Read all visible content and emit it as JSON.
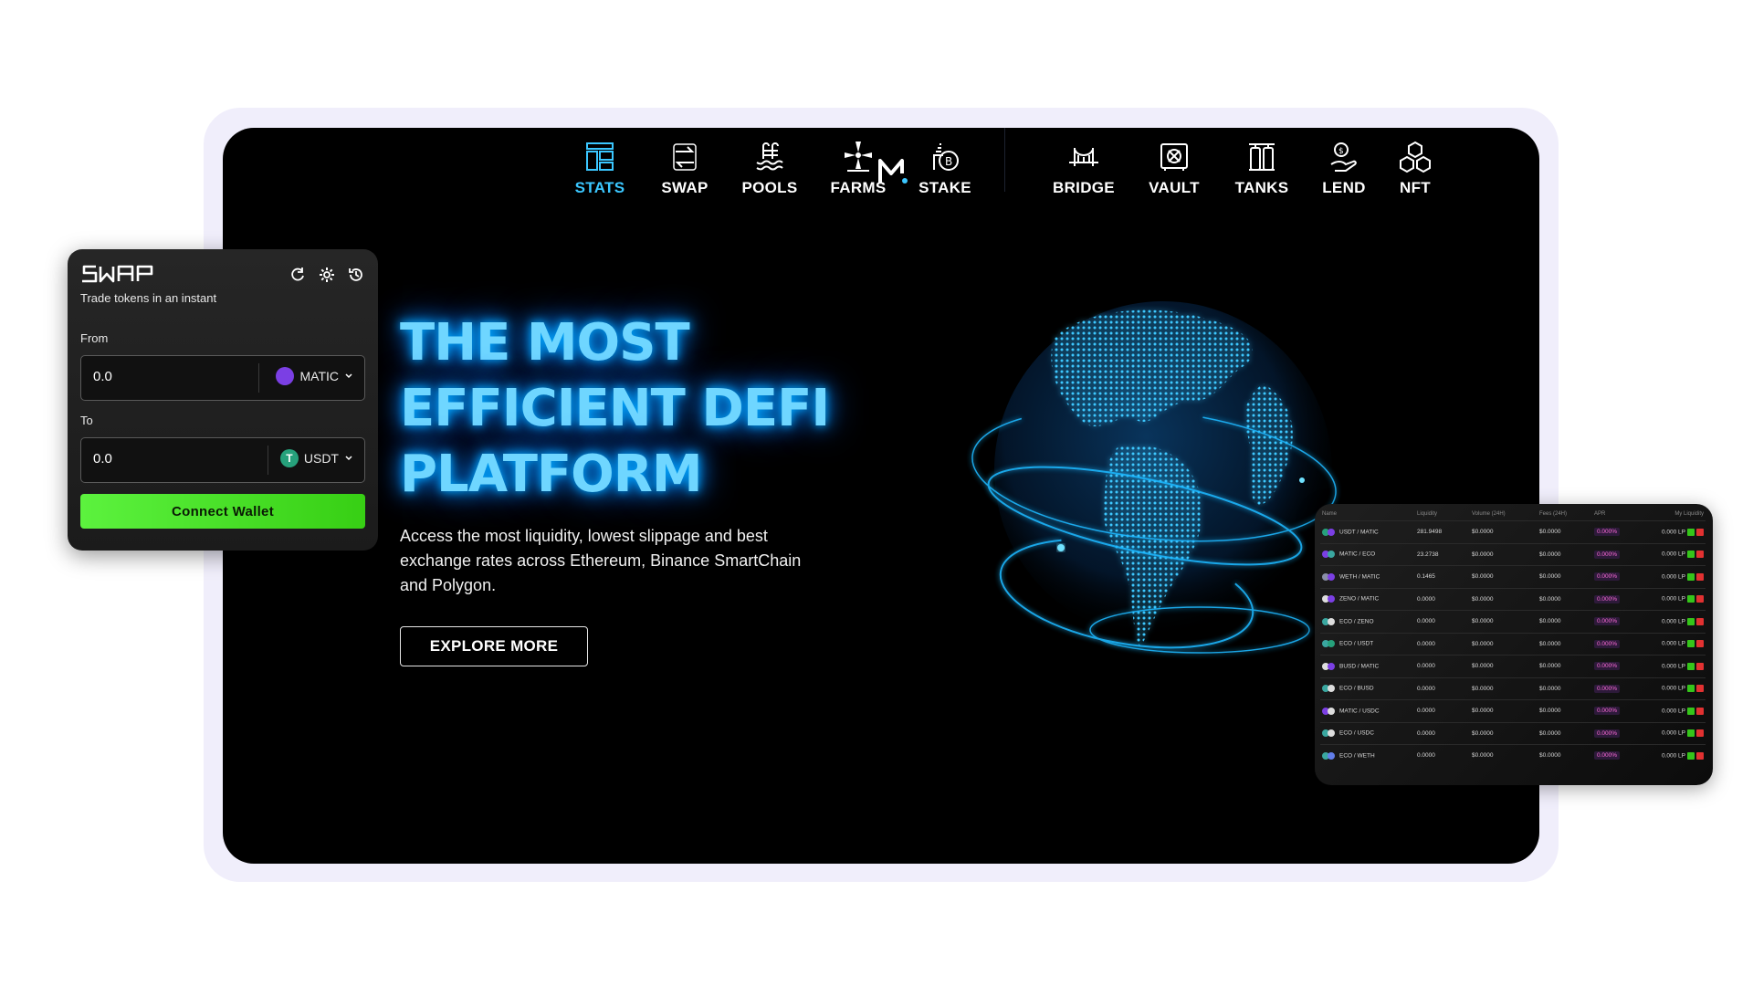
{
  "nav": {
    "left": [
      {
        "label": "STATS",
        "icon": "stats-icon",
        "active": true
      },
      {
        "label": "SWAP",
        "icon": "swap-icon",
        "active": false
      },
      {
        "label": "POOLS",
        "icon": "pools-icon",
        "active": false
      },
      {
        "label": "FARMS",
        "icon": "farms-icon",
        "active": false
      },
      {
        "label": "STAKE",
        "icon": "stake-icon",
        "active": false
      }
    ],
    "right": [
      {
        "label": "BRIDGE",
        "icon": "bridge-icon"
      },
      {
        "label": "VAULT",
        "icon": "vault-icon"
      },
      {
        "label": "TANKS",
        "icon": "tanks-icon"
      },
      {
        "label": "LEND",
        "icon": "lend-icon"
      },
      {
        "label": "NFT",
        "icon": "nft-icon"
      }
    ],
    "logo_icon": "m-logo-icon"
  },
  "hero": {
    "title_line1": "THE MOST",
    "title_line2": "EFFICIENT DEFI",
    "title_line3": "PLATFORM",
    "description": "Access the most liquidity, lowest slippage and best exchange rates across Ethereum, Binance SmartChain and Polygon.",
    "button_label": "EXPLORE MORE"
  },
  "swap": {
    "logo_text": "SWAP",
    "subtitle": "Trade tokens in an instant",
    "from_label": "From",
    "from_value": "0.0",
    "from_token": "MATIC",
    "to_label": "To",
    "to_value": "0.0",
    "to_token": "USDT",
    "connect_label": "Connect Wallet",
    "tool_icons": [
      "refresh-icon",
      "settings-gear-icon",
      "history-icon"
    ]
  },
  "pools": {
    "headers": [
      "Name",
      "Liquidity",
      "Volume (24H)",
      "Fees (24H)",
      "APR",
      "My Liquidity"
    ],
    "rows": [
      {
        "pair": "USDT / MATIC",
        "liquidity": "281.9498",
        "volume": "$0.0000",
        "fees": "$0.0000",
        "apr": "0.000%",
        "my": "0.000 LP",
        "c1": "#26a17b",
        "c2": "#7b3fe4"
      },
      {
        "pair": "MATIC / ECO",
        "liquidity": "23.2738",
        "volume": "$0.0000",
        "fees": "$0.0000",
        "apr": "0.000%",
        "my": "0.000 LP",
        "c1": "#7b3fe4",
        "c2": "#3aa7a0"
      },
      {
        "pair": "WETH / MATIC",
        "liquidity": "0.1465",
        "volume": "$0.0000",
        "fees": "$0.0000",
        "apr": "0.000%",
        "my": "0.000 LP",
        "c1": "#8a8fa8",
        "c2": "#7b3fe4"
      },
      {
        "pair": "ZENO / MATIC",
        "liquidity": "0.0000",
        "volume": "$0.0000",
        "fees": "$0.0000",
        "apr": "0.000%",
        "my": "0.000 LP",
        "c1": "#dddddd",
        "c2": "#7b3fe4"
      },
      {
        "pair": "ECO / ZENO",
        "liquidity": "0.0000",
        "volume": "$0.0000",
        "fees": "$0.0000",
        "apr": "0.000%",
        "my": "0.000 LP",
        "c1": "#3aa7a0",
        "c2": "#dddddd"
      },
      {
        "pair": "ECO / USDT",
        "liquidity": "0.0000",
        "volume": "$0.0000",
        "fees": "$0.0000",
        "apr": "0.000%",
        "my": "0.000 LP",
        "c1": "#3aa7a0",
        "c2": "#26a17b"
      },
      {
        "pair": "BUSD / MATIC",
        "liquidity": "0.0000",
        "volume": "$0.0000",
        "fees": "$0.0000",
        "apr": "0.000%",
        "my": "0.000 LP",
        "c1": "#dddddd",
        "c2": "#7b3fe4"
      },
      {
        "pair": "ECO / BUSD",
        "liquidity": "0.0000",
        "volume": "$0.0000",
        "fees": "$0.0000",
        "apr": "0.000%",
        "my": "0.000 LP",
        "c1": "#3aa7a0",
        "c2": "#dddddd"
      },
      {
        "pair": "MATIC / USDC",
        "liquidity": "0.0000",
        "volume": "$0.0000",
        "fees": "$0.0000",
        "apr": "0.000%",
        "my": "0.000 LP",
        "c1": "#7b3fe4",
        "c2": "#dddddd"
      },
      {
        "pair": "ECO / USDC",
        "liquidity": "0.0000",
        "volume": "$0.0000",
        "fees": "$0.0000",
        "apr": "0.000%",
        "my": "0.000 LP",
        "c1": "#3aa7a0",
        "c2": "#dddddd"
      },
      {
        "pair": "ECO / WETH",
        "liquidity": "0.0000",
        "volume": "$0.0000",
        "fees": "$0.0000",
        "apr": "0.000%",
        "my": "0.000 LP",
        "c1": "#3aa7a0",
        "c2": "#627eea"
      }
    ]
  },
  "colors": {
    "accent": "#3bc7ff",
    "connect_button": "#4be02a",
    "apr_text": "#ff6bd9"
  }
}
